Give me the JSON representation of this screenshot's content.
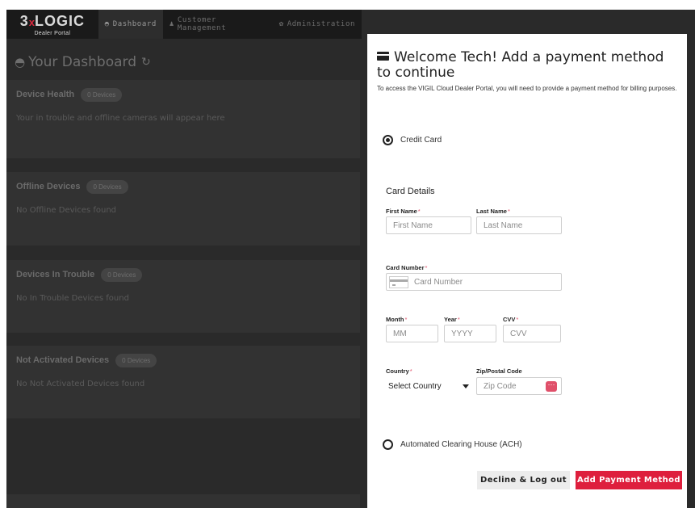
{
  "brand": {
    "logo_prefix": "3",
    "logo_x": "x",
    "logo_main": "LOGIC",
    "logo_sub": "Dealer Portal",
    "accent_color": "#de1f3d"
  },
  "nav": {
    "items": [
      {
        "label": "Dashboard",
        "icon": "dashboard-gauge-icon",
        "active": true
      },
      {
        "label": "Customer Management",
        "icon": "users-icon",
        "active": false
      },
      {
        "label": "Administration",
        "icon": "gear-icon",
        "active": false
      }
    ]
  },
  "dashboard": {
    "title": "Your Dashboard",
    "title_icon": "dashboard-gauge-icon",
    "refresh_icon": "refresh-icon",
    "cards": [
      {
        "title": "Device Health",
        "badge": "0 Devices",
        "body": "Your in trouble and offline cameras will appear here"
      },
      {
        "title": "Offline Devices",
        "badge": "0 Devices",
        "body": "No Offline Devices found"
      },
      {
        "title": "Devices In Trouble",
        "badge": "0 Devices",
        "body": "No In Trouble Devices found"
      },
      {
        "title": "Not Activated Devices",
        "badge": "0 Devices",
        "body": "No Not Activated Devices found"
      }
    ]
  },
  "modal": {
    "title": "Welcome Tech! Add a payment method to continue",
    "title_icon": "credit-card-icon",
    "subtitle": "To access the VIGIL Cloud Dealer Portal, you will need to provide a payment method for billing purposes.",
    "options": {
      "credit_card": {
        "label": "Credit Card",
        "selected": true
      },
      "ach": {
        "label": "Automated Clearing House (ACH)",
        "selected": false
      }
    },
    "card_details": {
      "section_title": "Card Details",
      "required_mark": "*",
      "first_name": {
        "label": "First Name",
        "placeholder": "First Name",
        "value": ""
      },
      "last_name": {
        "label": "Last Name",
        "placeholder": "Last Name",
        "value": ""
      },
      "card_number": {
        "label": "Card Number",
        "placeholder": "Card Number",
        "value": ""
      },
      "month": {
        "label": "Month",
        "placeholder": "MM",
        "value": ""
      },
      "year": {
        "label": "Year",
        "placeholder": "YYYY",
        "value": ""
      },
      "cvv": {
        "label": "CVV",
        "placeholder": "CVV",
        "value": ""
      },
      "country": {
        "label": "Country",
        "selected": "Select Country"
      },
      "zip": {
        "label": "Zip/Postal Code",
        "placeholder": "Zip Code",
        "value": ""
      }
    },
    "buttons": {
      "decline": "Decline & Log out",
      "add": "Add Payment Method"
    }
  }
}
